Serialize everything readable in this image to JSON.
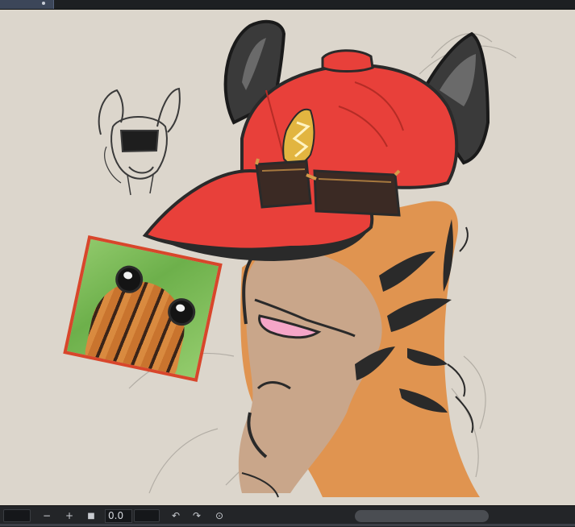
{
  "window": {
    "active_tab_indicator": "tab-dot"
  },
  "canvas": {
    "background_color": "#dcd6cc",
    "artwork_description_icons": [
      "sketch-thumbnail",
      "reference-photo",
      "tiger-character-illustration"
    ]
  },
  "statusbar": {
    "minus_label": "−",
    "plus_label": "+",
    "stop_label": "■",
    "zoom_value": "0.0",
    "rotate_left_label": "↶",
    "rotate_right_label": "↷",
    "reset_label": "⊙"
  },
  "colors": {
    "cap_red": "#e8403a",
    "cap_dark": "#2a2a2a",
    "tiger_orange": "#e09450",
    "skin_beige": "#c9a68a",
    "nose_pink": "#f5a6c8",
    "badge_gold": "#e2b540"
  }
}
